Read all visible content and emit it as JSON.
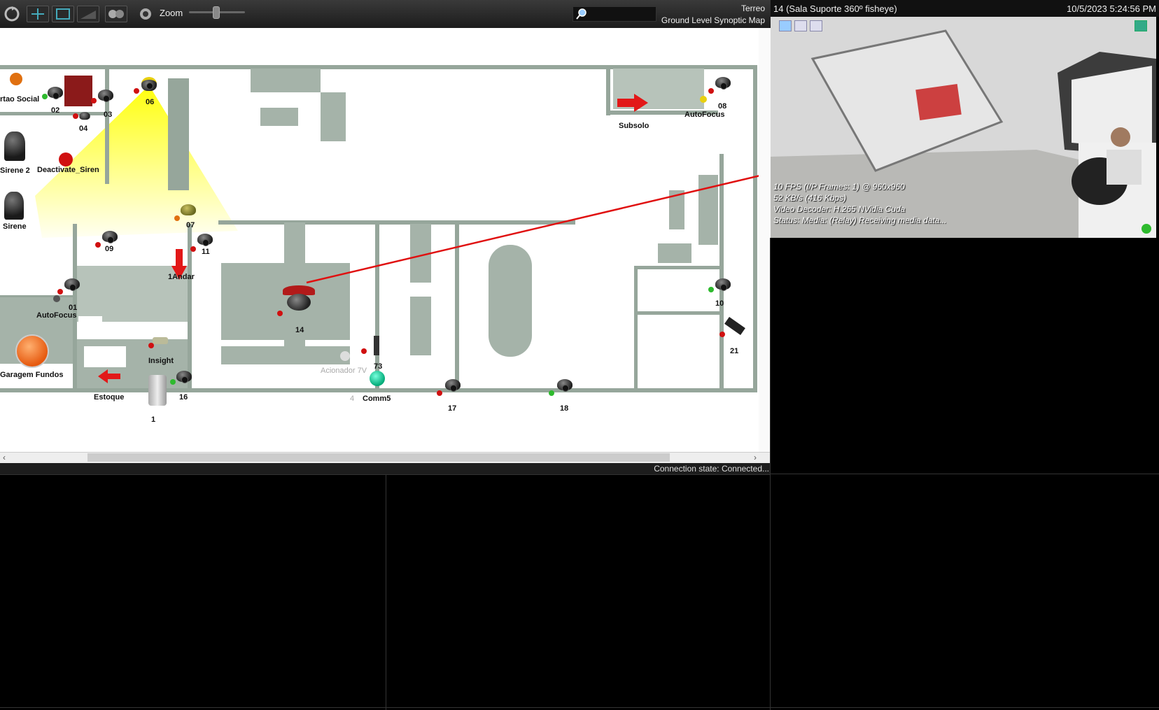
{
  "toolbar": {
    "zoom_label": "Zoom",
    "map_title_line1": "Terreo",
    "map_title_line2": "Ground Level Synoptic Map"
  },
  "map": {
    "labels": {
      "portao_social": "rtao Social",
      "cam02": "02",
      "cam03": "03",
      "cam04": "04",
      "cam06": "06",
      "cam08": "08",
      "autofocus_top": "AutoFocus",
      "subsolo": "Subsolo",
      "sirene2": "Sirene 2",
      "deactivate_siren": "Deactivate_Siren",
      "sirene": "Sirene",
      "cam07": "07",
      "cam11": "11",
      "cam09": "09",
      "andar1": "1Andar",
      "cam01": "01",
      "autofocus_left": "AutoFocus",
      "cam14": "14",
      "cam10": "10",
      "cam21": "21",
      "garagem": "Garagem Fundos",
      "insight": "Insight",
      "acionador": "Acionador 7V",
      "cam73": "73",
      "estoque": "Estoque",
      "cam16": "16",
      "comm5": "Comm5",
      "num4": "4",
      "cam17": "17",
      "cam18": "18",
      "num1": "1"
    }
  },
  "status": {
    "connection": "Connection state: Connected..."
  },
  "video": {
    "title": "14 (Sala Suporte 360º fisheye)",
    "timestamp": "10/5/2023 5:24:56 PM",
    "info": [
      "10 FPS (I/P Frames: 1) @ 960x960",
      "52 KB/s (416 Kbps)",
      "Video Decoder: H.265 NVidia Cuda",
      "Status: Media: (Relay) Receiving media data..."
    ]
  },
  "colors": {
    "accent_red": "#d01010",
    "wall": "#96a69b",
    "fov_yellow": "#ffff00"
  }
}
